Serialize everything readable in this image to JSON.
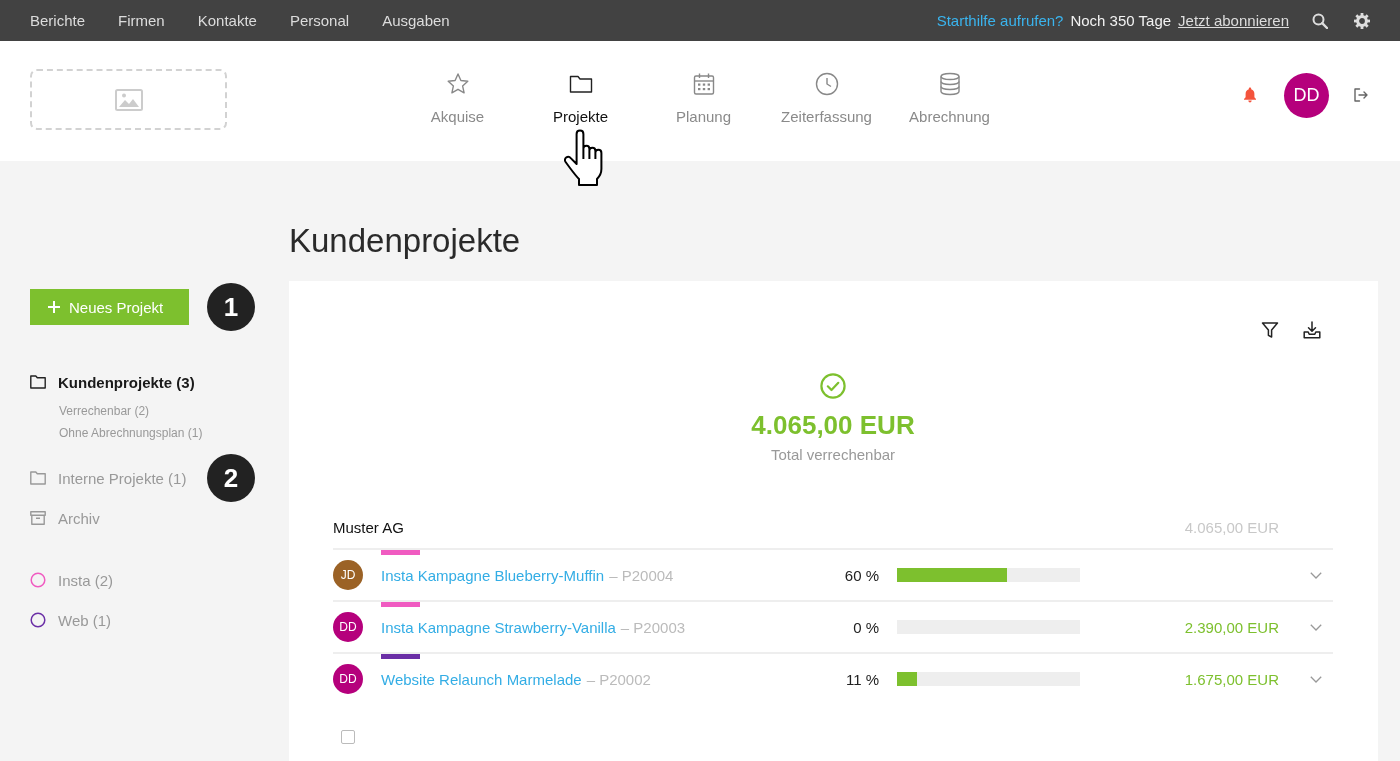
{
  "top_bar": {
    "menu": [
      {
        "label": "Berichte"
      },
      {
        "label": "Firmen"
      },
      {
        "label": "Kontakte"
      },
      {
        "label": "Personal"
      },
      {
        "label": "Ausgaben"
      }
    ],
    "help_link": "Starthilfe aufrufen?",
    "trial_notice": "Noch 350 Tage",
    "subscribe_link": "Jetzt abonnieren"
  },
  "header": {
    "nav": [
      {
        "label": "Akquise",
        "kind": "star",
        "selected": false
      },
      {
        "label": "Projekte",
        "kind": "folder",
        "selected": true
      },
      {
        "label": "Planung",
        "kind": "calendar",
        "selected": false
      },
      {
        "label": "Zeiterfassung",
        "kind": "clock",
        "selected": false
      },
      {
        "label": "Abrechnung",
        "kind": "database",
        "selected": false
      }
    ],
    "user_avatar": "DD"
  },
  "page_title": "Kundenprojekte",
  "sidebar": {
    "new_project_button": {
      "label": "Neues Projekt",
      "callout": "1"
    },
    "folders": [
      {
        "kind": "folder",
        "label": "Kundenprojekte (3)",
        "selected": true,
        "children": [
          {
            "label": "Verrechenbar (2)"
          },
          {
            "label": "Ohne Abrechnungsplan (1)"
          }
        ]
      },
      {
        "kind": "folder",
        "label": "Interne Projekte (1)",
        "selected": false,
        "callout": "2"
      },
      {
        "kind": "archive",
        "label": "Archiv",
        "selected": false
      }
    ],
    "tags": [
      {
        "label": "Insta (2)",
        "color": "#f05bc1"
      },
      {
        "label": "Web (1)",
        "color": "#6b2fa6"
      }
    ]
  },
  "summary": {
    "amount": "4.065,00 EUR",
    "label": "Total verrechenbar"
  },
  "groups": [
    {
      "name": "Muster AG",
      "total": "4.065,00 EUR",
      "projects": [
        {
          "avatar": {
            "initials": "JD",
            "color": "#9b6226"
          },
          "tag": {
            "color": "#f05bc1"
          },
          "name": "Insta Kampagne Blueberry-Muffin",
          "code": "– P20004",
          "progress": "60 %",
          "level": 0.6
        },
        {
          "avatar": {
            "initials": "DD",
            "color": "#b5007c"
          },
          "tag": {
            "color": "#f05bc1"
          },
          "name": "Insta Kampagne Strawberry-Vanilla",
          "code": "– P20003",
          "progress": "0 %",
          "level": 0,
          "amount": "2.390,00 EUR"
        },
        {
          "avatar": {
            "initials": "DD",
            "color": "#b5007c"
          },
          "tag": {
            "color": "#6b2fa6"
          },
          "name": "Website Relaunch Marmelade",
          "code": "– P20002",
          "progress": "11 %",
          "level": 0.11,
          "amount": "1.675,00 EUR"
        }
      ]
    }
  ],
  "select_all": {
    "checked": false
  }
}
